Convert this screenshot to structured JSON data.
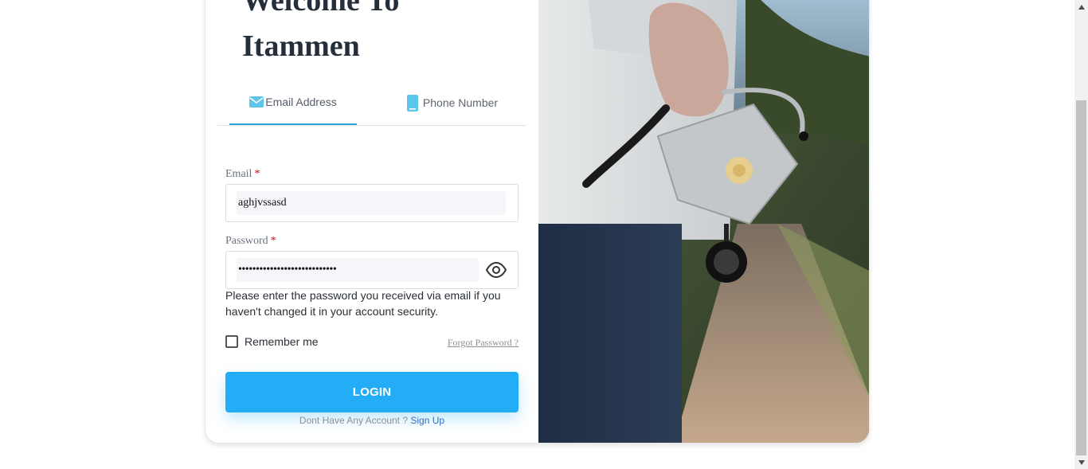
{
  "header": {
    "title": "Welcome To Itammen"
  },
  "tabs": [
    {
      "label": "Email Address",
      "icon": "envelope-icon",
      "active": true
    },
    {
      "label": "Phone Number",
      "icon": "phone-icon",
      "active": false
    }
  ],
  "form": {
    "email_label": "Email",
    "email_value": "aghjvssasd",
    "password_label": "Password",
    "password_value": "••••••••••••••••••••••••••••",
    "required_mark": "*",
    "password_hint": "Please enter the password you received via email if you haven't changed it in your account security.",
    "remember_label": "Remember me",
    "remember_checked": false,
    "forgot_label": "Forgot Password ?",
    "login_label": "LOGIN",
    "signup_prompt": "Dont Have Any Account ?",
    "signup_link": "Sign Up"
  },
  "colors": {
    "accent": "#22adf6",
    "tab_underline": "#29a3d6",
    "title": "#252e3b",
    "required": "#d0021b",
    "link": "#2f6ebd"
  },
  "image": {
    "subject": "doctor holding stethoscope and face mask",
    "icon": "doctor-photo"
  }
}
